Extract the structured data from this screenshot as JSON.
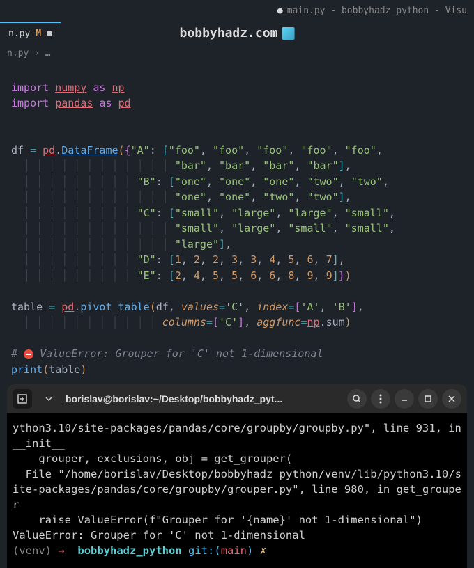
{
  "window": {
    "title": "main.py - bobbyhadz_python - Visu",
    "dot": "●"
  },
  "tab": {
    "filename": "n.py",
    "modified_marker": "M"
  },
  "watermark": {
    "text": "bobbyhadz.com"
  },
  "breadcrumb": {
    "path": "n.py",
    "sep": "›",
    "dots": "…"
  },
  "code": {
    "import_kw": "import",
    "as_kw": "as",
    "numpy": "numpy",
    "np": "np",
    "pandas": "pandas",
    "pd": "pd",
    "df": "df",
    "DataFrame": "DataFrame",
    "keys": {
      "A": "\"A\"",
      "B": "\"B\"",
      "C": "\"C\"",
      "D": "\"D\"",
      "E": "\"E\""
    },
    "strings": {
      "foo": "\"foo\"",
      "bar": "\"bar\"",
      "one": "\"one\"",
      "two": "\"two\"",
      "small": "\"small\"",
      "large": "\"large\""
    },
    "nums": {
      "n1": "1",
      "n2": "2",
      "n3": "3",
      "n4": "4",
      "n5": "5",
      "n6": "6",
      "n7": "7",
      "n8": "8",
      "n9": "9"
    },
    "table_var": "table",
    "pivot_table": "pivot_table",
    "values_kw": "values",
    "index_kw": "index",
    "columns_kw": "columns",
    "aggfunc_kw": "aggfunc",
    "c_str": "'C'",
    "a_str": "'A'",
    "b_str": "'B'",
    "sum": "sum",
    "comment": " ValueError: Grouper for 'C' not 1-dimensional",
    "print": "print"
  },
  "terminal": {
    "title": "borislav@borislav:~/Desktop/bobbyhadz_pyt...",
    "output": {
      "l1": "ython3.10/site-packages/pandas/core/groupby/groupby.py\", line 931, in __init__",
      "l2": "    grouper, exclusions, obj = get_grouper(",
      "l3": "  File \"/home/borislav/Desktop/bobbyhadz_python/venv/lib/python3.10/site-packages/pandas/core/groupby/grouper.py\", line 980, in get_grouper",
      "l4": "    raise ValueError(f\"Grouper for '{name}' not 1-dimensional\")",
      "l5": "ValueError: Grouper for 'C' not 1-dimensional"
    },
    "prompt": {
      "venv": "(venv)",
      "arrow": "→",
      "dir": "bobbyhadz_python",
      "git_label": "git:(",
      "branch": "main",
      "git_close": ")",
      "lightning": "✗"
    }
  }
}
